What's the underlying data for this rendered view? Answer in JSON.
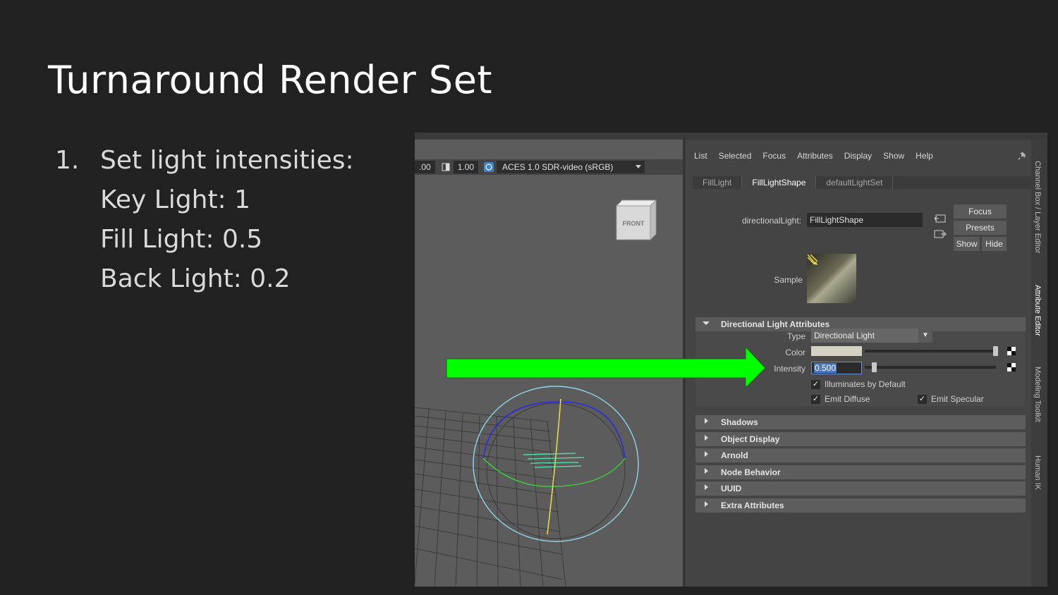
{
  "slide": {
    "title": "Turnaround Render Set",
    "bullets": {
      "num": "1.",
      "heading": "Set light intensities:",
      "lines": [
        "Key Light: 1",
        "Fill Light: 0.5",
        "Back Light: 0.2"
      ]
    }
  },
  "viewport": {
    "toolbar": {
      "value_a": ".00",
      "value_b": "1.00",
      "color_space": "ACES 1.0 SDR-video (sRGB)"
    },
    "viewcube_label": "FRONT"
  },
  "attribute_editor": {
    "menu": [
      "List",
      "Selected",
      "Focus",
      "Attributes",
      "Display",
      "Show",
      "Help"
    ],
    "tabs": [
      "FillLight",
      "FillLightShape",
      "defaultLightSet"
    ],
    "active_tab": "FillLightShape",
    "node_type_label": "directionalLight:",
    "node_name": "FillLightShape",
    "buttons": {
      "focus": "Focus",
      "presets": "Presets",
      "show": "Show",
      "hide": "Hide"
    },
    "sample_label": "Sample",
    "section_title": "Directional Light Attributes",
    "type_label": "Type",
    "type_value": "Directional Light",
    "color_label": "Color",
    "color_value": "#d4d2c3",
    "intensity_label": "Intensity",
    "intensity_value": "0.500",
    "checkboxes": {
      "illuminates": "Illuminates by Default",
      "emit_diffuse": "Emit Diffuse",
      "emit_specular": "Emit Specular"
    },
    "collapsed_sections": [
      "Shadows",
      "Object Display",
      "Arnold",
      "Node Behavior",
      "UUID",
      "Extra Attributes"
    ]
  },
  "dock_tabs": [
    "Channel Box / Layer Editor",
    "Attribute Editor",
    "Modeling Toolkit",
    "Human IK"
  ],
  "annotation": {
    "arrow_color": "#00ff00"
  }
}
